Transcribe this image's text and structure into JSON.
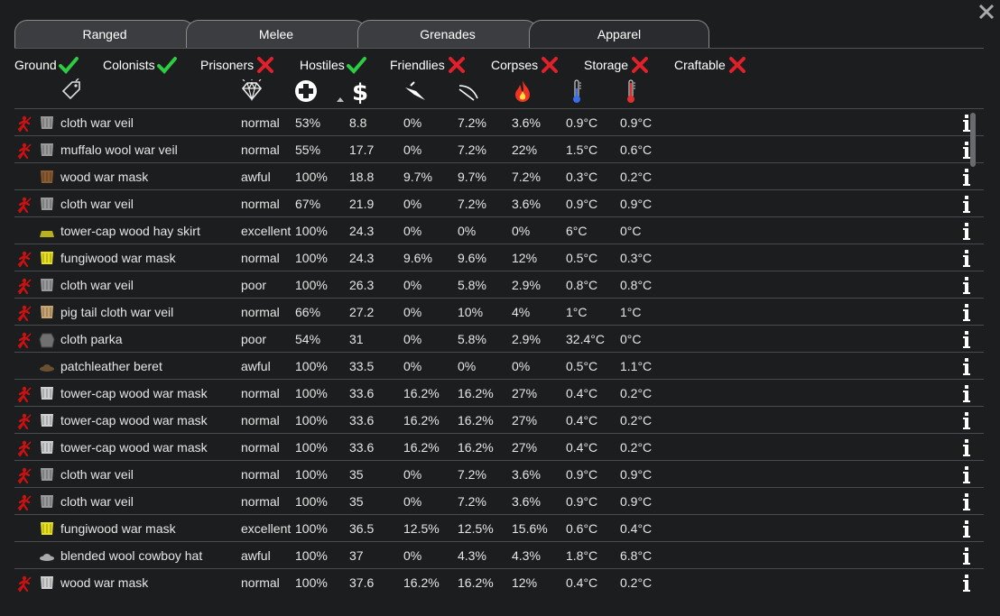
{
  "window": {
    "close_label": "✕"
  },
  "tabs": [
    {
      "label": "Ranged",
      "active": false
    },
    {
      "label": "Melee",
      "active": false
    },
    {
      "label": "Grenades",
      "active": false
    },
    {
      "label": "Apparel",
      "active": true
    }
  ],
  "filters": [
    {
      "label": "Ground",
      "on": true
    },
    {
      "label": "Colonists",
      "on": true
    },
    {
      "label": "Prisoners",
      "on": false
    },
    {
      "label": "Hostiles",
      "on": true
    },
    {
      "label": "Friendlies",
      "on": false
    },
    {
      "label": "Corpses",
      "on": false
    },
    {
      "label": "Storage",
      "on": false
    },
    {
      "label": "Craftable",
      "on": false
    }
  ],
  "columns": [
    {
      "icon": "tag-icon"
    },
    {
      "icon": "quality-diamond-icon"
    },
    {
      "icon": "hitpoints-cross-icon"
    },
    {
      "icon": "market-value-dollar-icon",
      "sorted": "ascending"
    },
    {
      "icon": "sharp-armor-icon"
    },
    {
      "icon": "blunt-armor-icon"
    },
    {
      "icon": "heat-armor-flame-icon"
    },
    {
      "icon": "insulation-cold-thermometer-icon"
    },
    {
      "icon": "insulation-heat-thermometer-icon"
    }
  ],
  "colors": {
    "check_green": "#2ecc40",
    "cross_red": "#e0202a",
    "forbid_red": "#cc1111"
  },
  "rows": [
    {
      "forbidden": true,
      "icon": "veil",
      "name": "cloth war veil",
      "quality": "normal",
      "hp": "53%",
      "value": "8.8",
      "sharp": "0%",
      "blunt": "7.2%",
      "heat": "3.6%",
      "cold": "0.9°C",
      "hot": "0.9°C"
    },
    {
      "forbidden": true,
      "icon": "veil",
      "name": "muffalo wool war veil",
      "quality": "normal",
      "hp": "55%",
      "value": "17.7",
      "sharp": "0%",
      "blunt": "7.2%",
      "heat": "22%",
      "cold": "1.5°C",
      "hot": "0.6°C"
    },
    {
      "forbidden": false,
      "icon": "mask-brown",
      "name": "wood war mask",
      "quality": "awful",
      "hp": "100%",
      "value": "18.8",
      "sharp": "9.7%",
      "blunt": "9.7%",
      "heat": "7.2%",
      "cold": "0.3°C",
      "hot": "0.2°C"
    },
    {
      "forbidden": true,
      "icon": "veil",
      "name": "cloth war veil",
      "quality": "normal",
      "hp": "67%",
      "value": "21.9",
      "sharp": "0%",
      "blunt": "7.2%",
      "heat": "3.6%",
      "cold": "0.9°C",
      "hot": "0.9°C"
    },
    {
      "forbidden": false,
      "icon": "skirt",
      "name": "tower-cap wood hay skirt",
      "quality": "excellent",
      "hp": "100%",
      "value": "24.3",
      "sharp": "0%",
      "blunt": "0%",
      "heat": "0%",
      "cold": "6°C",
      "hot": "0°C"
    },
    {
      "forbidden": true,
      "icon": "mask-yellow",
      "name": "fungiwood war mask",
      "quality": "normal",
      "hp": "100%",
      "value": "24.3",
      "sharp": "9.6%",
      "blunt": "9.6%",
      "heat": "12%",
      "cold": "0.5°C",
      "hot": "0.3°C"
    },
    {
      "forbidden": true,
      "icon": "veil",
      "name": "cloth war veil",
      "quality": "poor",
      "hp": "100%",
      "value": "26.3",
      "sharp": "0%",
      "blunt": "5.8%",
      "heat": "2.9%",
      "cold": "0.8°C",
      "hot": "0.8°C"
    },
    {
      "forbidden": true,
      "icon": "veil-tan",
      "name": "pig tail cloth war veil",
      "quality": "normal",
      "hp": "66%",
      "value": "27.2",
      "sharp": "0%",
      "blunt": "10%",
      "heat": "4%",
      "cold": "1°C",
      "hot": "1°C"
    },
    {
      "forbidden": true,
      "icon": "parka",
      "name": "cloth parka",
      "quality": "poor",
      "hp": "54%",
      "value": "31",
      "sharp": "0%",
      "blunt": "5.8%",
      "heat": "2.9%",
      "cold": "32.4°C",
      "hot": "0°C"
    },
    {
      "forbidden": false,
      "icon": "beret",
      "name": "patchleather beret",
      "quality": "awful",
      "hp": "100%",
      "value": "33.5",
      "sharp": "0%",
      "blunt": "0%",
      "heat": "0%",
      "cold": "0.5°C",
      "hot": "1.1°C"
    },
    {
      "forbidden": true,
      "icon": "mask-grey",
      "name": "tower-cap wood war mask",
      "quality": "normal",
      "hp": "100%",
      "value": "33.6",
      "sharp": "16.2%",
      "blunt": "16.2%",
      "heat": "27%",
      "cold": "0.4°C",
      "hot": "0.2°C"
    },
    {
      "forbidden": true,
      "icon": "mask-grey",
      "name": "tower-cap wood war mask",
      "quality": "normal",
      "hp": "100%",
      "value": "33.6",
      "sharp": "16.2%",
      "blunt": "16.2%",
      "heat": "27%",
      "cold": "0.4°C",
      "hot": "0.2°C"
    },
    {
      "forbidden": true,
      "icon": "mask-grey",
      "name": "tower-cap wood war mask",
      "quality": "normal",
      "hp": "100%",
      "value": "33.6",
      "sharp": "16.2%",
      "blunt": "16.2%",
      "heat": "27%",
      "cold": "0.4°C",
      "hot": "0.2°C"
    },
    {
      "forbidden": true,
      "icon": "veil",
      "name": "cloth war veil",
      "quality": "normal",
      "hp": "100%",
      "value": "35",
      "sharp": "0%",
      "blunt": "7.2%",
      "heat": "3.6%",
      "cold": "0.9°C",
      "hot": "0.9°C"
    },
    {
      "forbidden": true,
      "icon": "veil",
      "name": "cloth war veil",
      "quality": "normal",
      "hp": "100%",
      "value": "35",
      "sharp": "0%",
      "blunt": "7.2%",
      "heat": "3.6%",
      "cold": "0.9°C",
      "hot": "0.9°C"
    },
    {
      "forbidden": false,
      "icon": "mask-yellow",
      "name": "fungiwood war mask",
      "quality": "excellent",
      "hp": "100%",
      "value": "36.5",
      "sharp": "12.5%",
      "blunt": "12.5%",
      "heat": "15.6%",
      "cold": "0.6°C",
      "hot": "0.4°C"
    },
    {
      "forbidden": false,
      "icon": "cowboy-hat",
      "name": "blended wool cowboy hat",
      "quality": "awful",
      "hp": "100%",
      "value": "37",
      "sharp": "0%",
      "blunt": "4.3%",
      "heat": "4.3%",
      "cold": "1.8°C",
      "hot": "6.8°C"
    },
    {
      "forbidden": true,
      "icon": "mask-grey",
      "name": "wood war mask",
      "quality": "normal",
      "hp": "100%",
      "value": "37.6",
      "sharp": "16.2%",
      "blunt": "16.2%",
      "heat": "12%",
      "cold": "0.4°C",
      "hot": "0.2°C"
    }
  ]
}
